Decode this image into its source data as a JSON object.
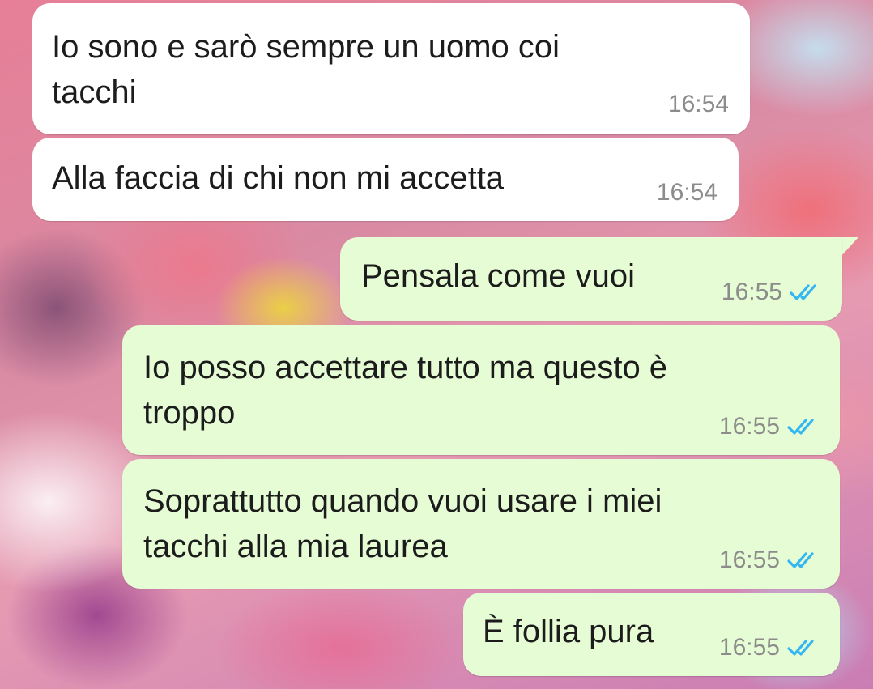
{
  "colors": {
    "incoming_bubble": "#ffffff",
    "outgoing_bubble": "#e6fcd5",
    "timestamp": "#8c8c8c",
    "read_ticks": "#34b7f1"
  },
  "messages": [
    {
      "direction": "incoming",
      "text": "Io sono e sarò sempre un uomo coi\ntacchi",
      "time": "16:54"
    },
    {
      "direction": "incoming",
      "text": "Alla faccia di chi non mi accetta",
      "time": "16:54"
    },
    {
      "direction": "outgoing",
      "text": "Pensala come vuoi",
      "time": "16:55",
      "status_icon": "double-check-read-icon"
    },
    {
      "direction": "outgoing",
      "text": "Io posso accettare tutto ma questo è\ntroppo",
      "time": "16:55",
      "status_icon": "double-check-read-icon"
    },
    {
      "direction": "outgoing",
      "text": "Soprattutto quando vuoi usare i miei\ntacchi alla mia laurea",
      "time": "16:55",
      "status_icon": "double-check-read-icon"
    },
    {
      "direction": "outgoing",
      "text": "È follia pura",
      "time": "16:55",
      "status_icon": "double-check-read-icon"
    }
  ]
}
